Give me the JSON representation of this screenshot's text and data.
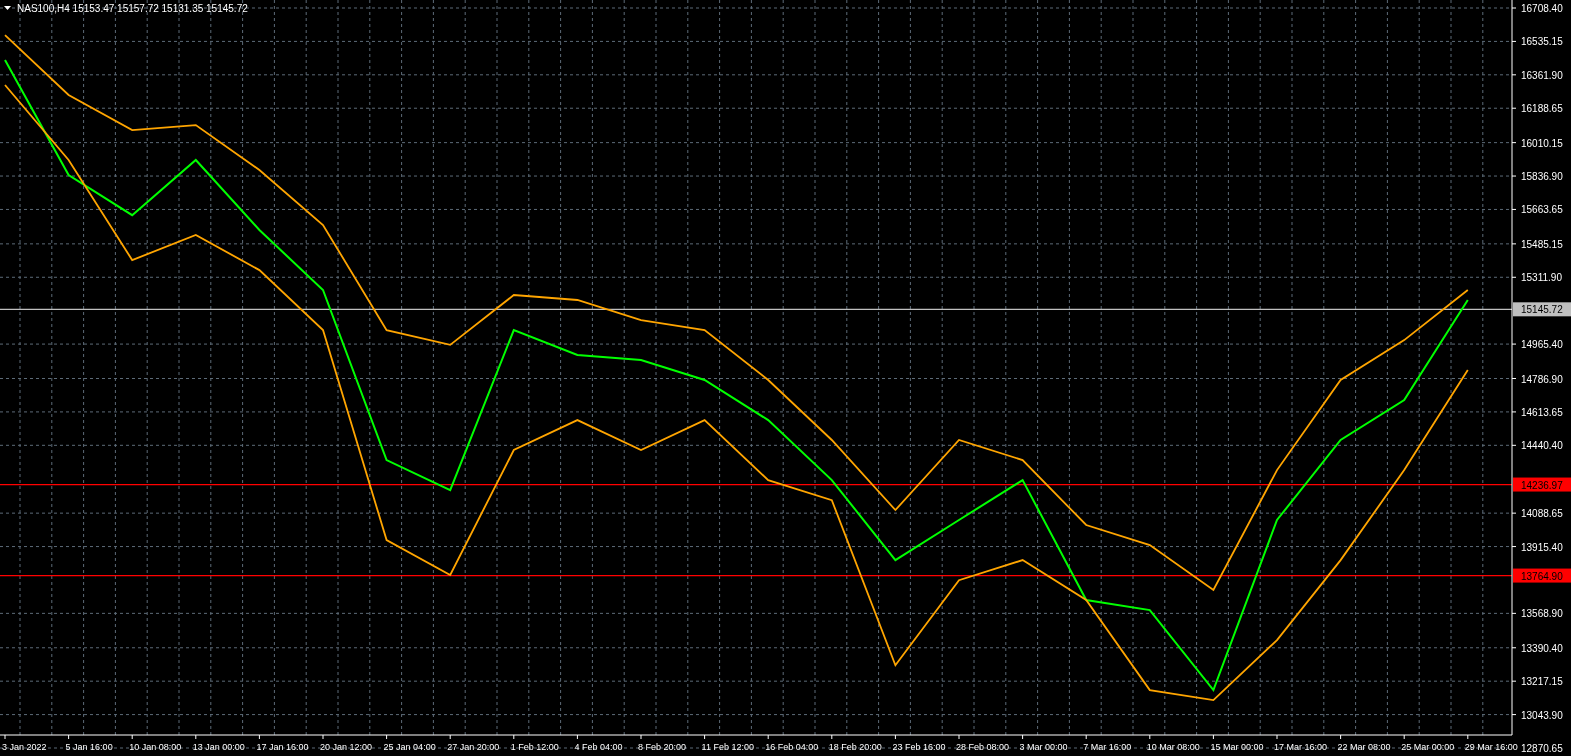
{
  "header": {
    "text": "NAS100,H4 15153.47 15157.72 15131.35 15145.72"
  },
  "chart_data": {
    "type": "line",
    "grid": true,
    "categories": [
      "3 Jan 2022",
      "5 Jan 16:00",
      "10 Jan 08:00",
      "13 Jan 00:00",
      "17 Jan 16:00",
      "20 Jan 12:00",
      "25 Jan 04:00",
      "27 Jan 20:00",
      "1 Feb 12:00",
      "4 Feb 04:00",
      "8 Feb 20:00",
      "11 Feb 12:00",
      "16 Feb 04:00",
      "18 Feb 20:00",
      "23 Feb 16:00",
      "28 Feb 08:00",
      "3 Mar 00:00",
      "7 Mar 16:00",
      "10 Mar 08:00",
      "15 Mar 00:00",
      "17 Mar 16:00",
      "22 Mar 08:00",
      "25 Mar 00:00",
      "29 Mar 16:00"
    ],
    "series": [
      {
        "color": "#00ff00",
        "values": [
          16438,
          15842,
          15634,
          15920,
          15557,
          15246,
          14364,
          14208,
          15038,
          14909,
          14883,
          14779,
          14571,
          14260,
          13845,
          14053,
          14260,
          13638,
          13586,
          13171,
          14053,
          14468,
          14675,
          15194
        ]
      },
      {
        "color": "#ffa500",
        "values": [
          16568,
          16257,
          16075,
          16101,
          15868,
          15583,
          15038,
          14961,
          15220,
          15194,
          15090,
          15038,
          14779,
          14468,
          14105,
          14468,
          14364,
          14027,
          13923,
          13690,
          14312,
          14779,
          14986,
          15246
        ]
      },
      {
        "color": "#ffa500",
        "values": [
          16309,
          15920,
          15401,
          15531,
          15349,
          15038,
          13949,
          13768,
          14416,
          14571,
          14416,
          14571,
          14260,
          14156,
          13300,
          13741,
          13845,
          13638,
          13171,
          13119,
          13430,
          13845,
          14312,
          14831
        ]
      }
    ],
    "ylim": [
      12870.65,
      16708.4
    ],
    "yticks": [
      {
        "value": 16708.4,
        "label": "16708.40"
      },
      16535.15,
      {
        "value": 16361.9,
        "label": "16361.90"
      },
      16188.65,
      16010.15,
      {
        "value": 15836.9,
        "label": "15836.90"
      },
      15663.65,
      15485.15,
      {
        "value": 15311.9,
        "label": "15311.90"
      },
      {
        "value": 14965.4,
        "label": "14965.40"
      },
      {
        "value": 14786.9,
        "label": "14786.90"
      },
      14613.65,
      {
        "value": 14440.4,
        "label": "14440.40"
      },
      14088.65,
      {
        "value": 13915.4,
        "label": "13915.40"
      },
      {
        "value": 13568.9,
        "label": "13568.90"
      },
      {
        "value": 13390.4,
        "label": "13390.40"
      },
      13217.15,
      {
        "value": 13043.9,
        "label": "13043.90"
      },
      12870.65
    ],
    "ref_lines": [
      {
        "axis": "y",
        "value": 15145.72,
        "label": "15145.72",
        "color": "#c0c0c0"
      },
      {
        "axis": "y",
        "value": 14236.97,
        "label": "14236.97",
        "color": "#ff0000"
      },
      {
        "axis": "y",
        "value": 13764.9,
        "label": "13764.90",
        "color": "#ff0000"
      }
    ]
  }
}
